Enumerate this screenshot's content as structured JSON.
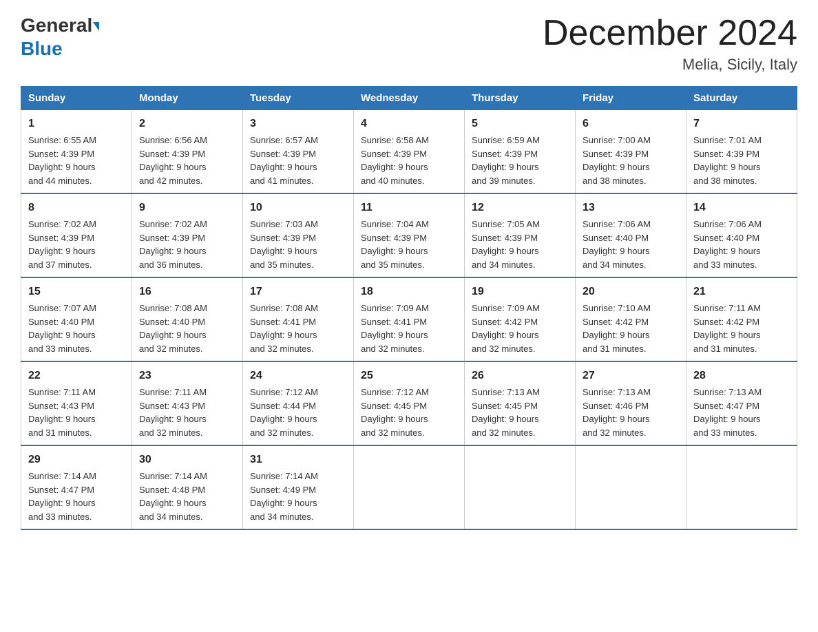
{
  "header": {
    "logo_line1": "General",
    "logo_line2": "Blue",
    "title": "December 2024",
    "location": "Melia, Sicily, Italy"
  },
  "days_of_week": [
    "Sunday",
    "Monday",
    "Tuesday",
    "Wednesday",
    "Thursday",
    "Friday",
    "Saturday"
  ],
  "weeks": [
    [
      {
        "day": "1",
        "sunrise": "6:55 AM",
        "sunset": "4:39 PM",
        "daylight": "9 hours and 44 minutes."
      },
      {
        "day": "2",
        "sunrise": "6:56 AM",
        "sunset": "4:39 PM",
        "daylight": "9 hours and 42 minutes."
      },
      {
        "day": "3",
        "sunrise": "6:57 AM",
        "sunset": "4:39 PM",
        "daylight": "9 hours and 41 minutes."
      },
      {
        "day": "4",
        "sunrise": "6:58 AM",
        "sunset": "4:39 PM",
        "daylight": "9 hours and 40 minutes."
      },
      {
        "day": "5",
        "sunrise": "6:59 AM",
        "sunset": "4:39 PM",
        "daylight": "9 hours and 39 minutes."
      },
      {
        "day": "6",
        "sunrise": "7:00 AM",
        "sunset": "4:39 PM",
        "daylight": "9 hours and 38 minutes."
      },
      {
        "day": "7",
        "sunrise": "7:01 AM",
        "sunset": "4:39 PM",
        "daylight": "9 hours and 38 minutes."
      }
    ],
    [
      {
        "day": "8",
        "sunrise": "7:02 AM",
        "sunset": "4:39 PM",
        "daylight": "9 hours and 37 minutes."
      },
      {
        "day": "9",
        "sunrise": "7:02 AM",
        "sunset": "4:39 PM",
        "daylight": "9 hours and 36 minutes."
      },
      {
        "day": "10",
        "sunrise": "7:03 AM",
        "sunset": "4:39 PM",
        "daylight": "9 hours and 35 minutes."
      },
      {
        "day": "11",
        "sunrise": "7:04 AM",
        "sunset": "4:39 PM",
        "daylight": "9 hours and 35 minutes."
      },
      {
        "day": "12",
        "sunrise": "7:05 AM",
        "sunset": "4:39 PM",
        "daylight": "9 hours and 34 minutes."
      },
      {
        "day": "13",
        "sunrise": "7:06 AM",
        "sunset": "4:40 PM",
        "daylight": "9 hours and 34 minutes."
      },
      {
        "day": "14",
        "sunrise": "7:06 AM",
        "sunset": "4:40 PM",
        "daylight": "9 hours and 33 minutes."
      }
    ],
    [
      {
        "day": "15",
        "sunrise": "7:07 AM",
        "sunset": "4:40 PM",
        "daylight": "9 hours and 33 minutes."
      },
      {
        "day": "16",
        "sunrise": "7:08 AM",
        "sunset": "4:40 PM",
        "daylight": "9 hours and 32 minutes."
      },
      {
        "day": "17",
        "sunrise": "7:08 AM",
        "sunset": "4:41 PM",
        "daylight": "9 hours and 32 minutes."
      },
      {
        "day": "18",
        "sunrise": "7:09 AM",
        "sunset": "4:41 PM",
        "daylight": "9 hours and 32 minutes."
      },
      {
        "day": "19",
        "sunrise": "7:09 AM",
        "sunset": "4:42 PM",
        "daylight": "9 hours and 32 minutes."
      },
      {
        "day": "20",
        "sunrise": "7:10 AM",
        "sunset": "4:42 PM",
        "daylight": "9 hours and 31 minutes."
      },
      {
        "day": "21",
        "sunrise": "7:11 AM",
        "sunset": "4:42 PM",
        "daylight": "9 hours and 31 minutes."
      }
    ],
    [
      {
        "day": "22",
        "sunrise": "7:11 AM",
        "sunset": "4:43 PM",
        "daylight": "9 hours and 31 minutes."
      },
      {
        "day": "23",
        "sunrise": "7:11 AM",
        "sunset": "4:43 PM",
        "daylight": "9 hours and 32 minutes."
      },
      {
        "day": "24",
        "sunrise": "7:12 AM",
        "sunset": "4:44 PM",
        "daylight": "9 hours and 32 minutes."
      },
      {
        "day": "25",
        "sunrise": "7:12 AM",
        "sunset": "4:45 PM",
        "daylight": "9 hours and 32 minutes."
      },
      {
        "day": "26",
        "sunrise": "7:13 AM",
        "sunset": "4:45 PM",
        "daylight": "9 hours and 32 minutes."
      },
      {
        "day": "27",
        "sunrise": "7:13 AM",
        "sunset": "4:46 PM",
        "daylight": "9 hours and 32 minutes."
      },
      {
        "day": "28",
        "sunrise": "7:13 AM",
        "sunset": "4:47 PM",
        "daylight": "9 hours and 33 minutes."
      }
    ],
    [
      {
        "day": "29",
        "sunrise": "7:14 AM",
        "sunset": "4:47 PM",
        "daylight": "9 hours and 33 minutes."
      },
      {
        "day": "30",
        "sunrise": "7:14 AM",
        "sunset": "4:48 PM",
        "daylight": "9 hours and 34 minutes."
      },
      {
        "day": "31",
        "sunrise": "7:14 AM",
        "sunset": "4:49 PM",
        "daylight": "9 hours and 34 minutes."
      },
      null,
      null,
      null,
      null
    ]
  ],
  "labels": {
    "sunrise": "Sunrise:",
    "sunset": "Sunset:",
    "daylight": "Daylight:"
  }
}
